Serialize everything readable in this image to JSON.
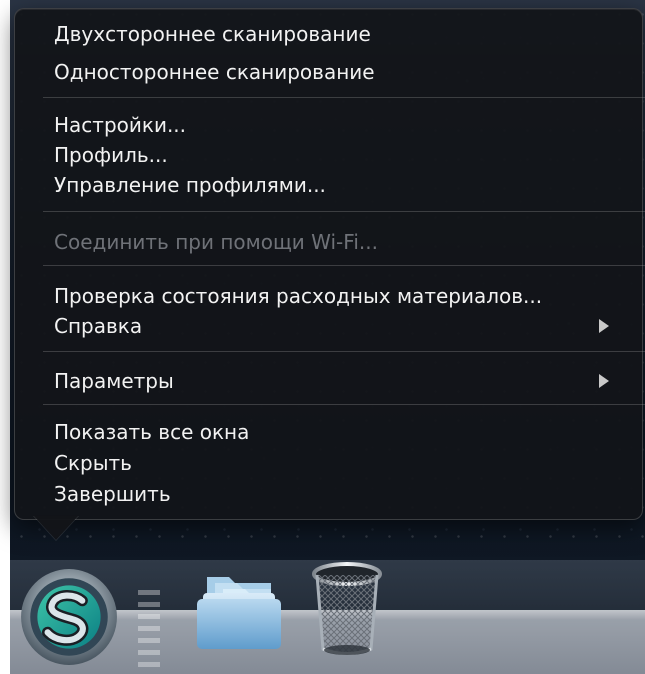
{
  "menu": {
    "items": [
      {
        "label": "Двухстороннее сканирование"
      },
      {
        "label": "Одностороннее сканирование"
      },
      {
        "label": "Настройки..."
      },
      {
        "label": "Профиль..."
      },
      {
        "label": "Управление профилями..."
      },
      {
        "label": "Соединить при помощи Wi-Fi..."
      },
      {
        "label": "Проверка состояния расходных материалов..."
      },
      {
        "label": "Справка"
      },
      {
        "label": "Параметры"
      },
      {
        "label": "Показать все окна"
      },
      {
        "label": "Скрыть"
      },
      {
        "label": "Завершить"
      }
    ]
  },
  "dock": {
    "icons": [
      {
        "name": "scan-app-icon"
      },
      {
        "name": "folder-icon"
      },
      {
        "name": "trash-icon"
      }
    ]
  }
}
